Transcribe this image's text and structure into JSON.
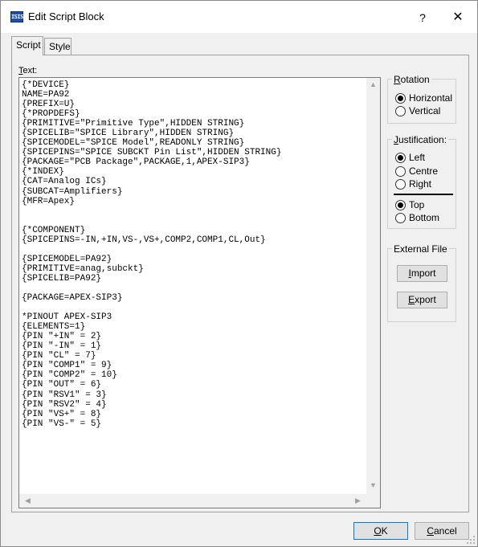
{
  "window": {
    "title": "Edit Script Block",
    "icon_text": "ISIS",
    "help_label": "?",
    "close_label": "✕"
  },
  "tabs": [
    {
      "label": "Script",
      "active": true
    },
    {
      "label": "Style",
      "active": false
    }
  ],
  "editor": {
    "label": "Text:",
    "content": "{*DEVICE}\nNAME=PA92\n{PREFIX=U}\n{*PROPDEFS}\n{PRIMITIVE=\"Primitive Type\",HIDDEN STRING}\n{SPICELIB=\"SPICE Library\",HIDDEN STRING}\n{SPICEMODEL=\"SPICE Model\",READONLY STRING}\n{SPICEPINS=\"SPICE SUBCKT Pin List\",HIDDEN STRING}\n{PACKAGE=\"PCB Package\",PACKAGE,1,APEX-SIP3}\n{*INDEX}\n{CAT=Analog ICs}\n{SUBCAT=Amplifiers}\n{MFR=Apex}\n\n\n{*COMPONENT}\n{SPICEPINS=-IN,+IN,VS-,VS+,COMP2,COMP1,CL,Out}\n\n{SPICEMODEL=PA92}\n{PRIMITIVE=anag,subckt}\n{SPICELIB=PA92}\n\n{PACKAGE=APEX-SIP3}\n\n*PINOUT APEX-SIP3\n{ELEMENTS=1}\n{PIN \"+IN\" = 2}\n{PIN \"-IN\" = 1}\n{PIN \"CL\" = 7}\n{PIN \"COMP1\" = 9}\n{PIN \"COMP2\" = 10}\n{PIN \"OUT\" = 6}\n{PIN \"RSV1\" = 3}\n{PIN \"RSV2\" = 4}\n{PIN \"VS+\" = 8}\n{PIN \"VS-\" = 5}"
  },
  "rotation": {
    "title": "Rotation",
    "options": [
      {
        "label": "Horizontal",
        "checked": true
      },
      {
        "label": "Vertical",
        "checked": false
      }
    ]
  },
  "justification": {
    "title": "Justification:",
    "horizontal": [
      {
        "label": "Left",
        "checked": true
      },
      {
        "label": "Centre",
        "checked": false
      },
      {
        "label": "Right",
        "checked": false
      }
    ],
    "vertical": [
      {
        "label": "Top",
        "checked": true
      },
      {
        "label": "Bottom",
        "checked": false
      }
    ]
  },
  "external_file": {
    "title": "External File",
    "import_label": "Import",
    "export_label": "Export"
  },
  "footer": {
    "ok_label": "OK",
    "cancel_label": "Cancel"
  },
  "colors": {
    "dialog_bg": "#f0f0f0",
    "default_button_border": "#0078d7"
  }
}
